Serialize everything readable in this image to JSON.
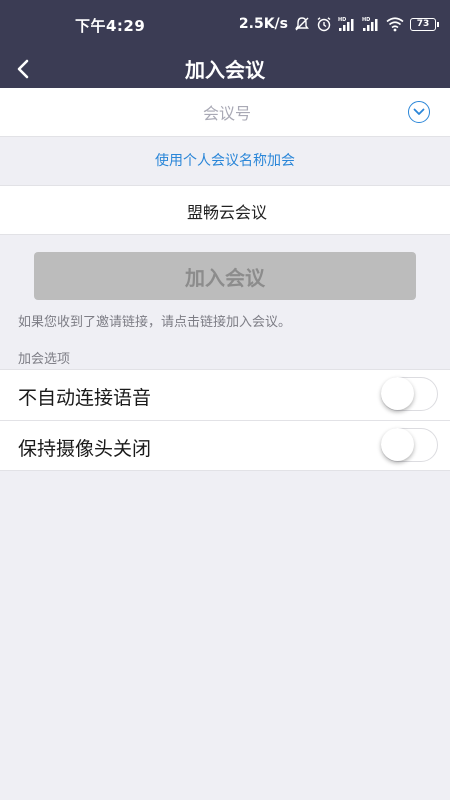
{
  "status_bar": {
    "time": "下午4:29",
    "net_speed": "2.5K/s",
    "battery": "73"
  },
  "nav": {
    "title": "加入会议",
    "back_icon": "chevron-left-icon"
  },
  "form": {
    "meeting_number_placeholder": "会议号",
    "dropdown_icon": "chevron-down-circle-icon",
    "personal_name_link": "使用个人会议名称加会",
    "display_name_value": "盟畅云会议",
    "join_button": "加入会议",
    "hint": "如果您收到了邀请链接，请点击链接加入会议。"
  },
  "options": {
    "section_title": "加会选项",
    "items": [
      {
        "label": "不自动连接语音",
        "on": false
      },
      {
        "label": "保持摄像头关闭",
        "on": false
      }
    ]
  },
  "colors": {
    "header_bg": "#3b3c54",
    "accent": "#2a86d8",
    "page_bg": "#efeff4",
    "button_disabled": "#bcbcbc"
  }
}
